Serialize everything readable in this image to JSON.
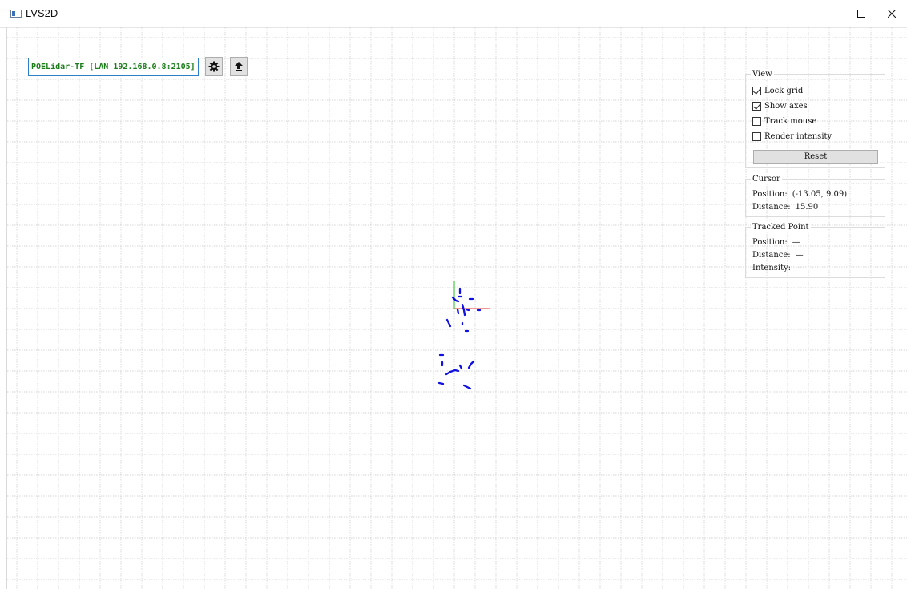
{
  "window": {
    "title": "LVS2D",
    "controls": [
      "minimize",
      "maximize",
      "close"
    ]
  },
  "toolbar": {
    "device": "POELidar-TF [LAN 192.168.0.8:2105]",
    "settings_icon": "gear-icon",
    "upload_icon": "upload-icon"
  },
  "view_panel": {
    "title": "View",
    "lock_grid": {
      "label": "Lock grid",
      "checked": true
    },
    "show_axes": {
      "label": "Show axes",
      "checked": true
    },
    "track_mouse": {
      "label": "Track mouse",
      "checked": false
    },
    "render_intensity": {
      "label": "Render intensity",
      "checked": false
    },
    "reset_label": "Reset"
  },
  "cursor_panel": {
    "title": "Cursor",
    "position_label": "Position:",
    "position_value": "(-13.05, 9.09)",
    "distance_label": "Distance:",
    "distance_value": "15.90"
  },
  "tracked_panel": {
    "title": "Tracked Point",
    "position_label": "Position:",
    "position_value": "—",
    "distance_label": "Distance:",
    "distance_value": "—",
    "intensity_label": "Intensity:",
    "intensity_value": "—"
  },
  "colors": {
    "grid": "#c8c8c8",
    "points": "#1010e0",
    "axis_x": "#e03030",
    "axis_y": "#20c020",
    "device_text": "#1a7d1a",
    "combo_border": "#2d7fc9"
  }
}
